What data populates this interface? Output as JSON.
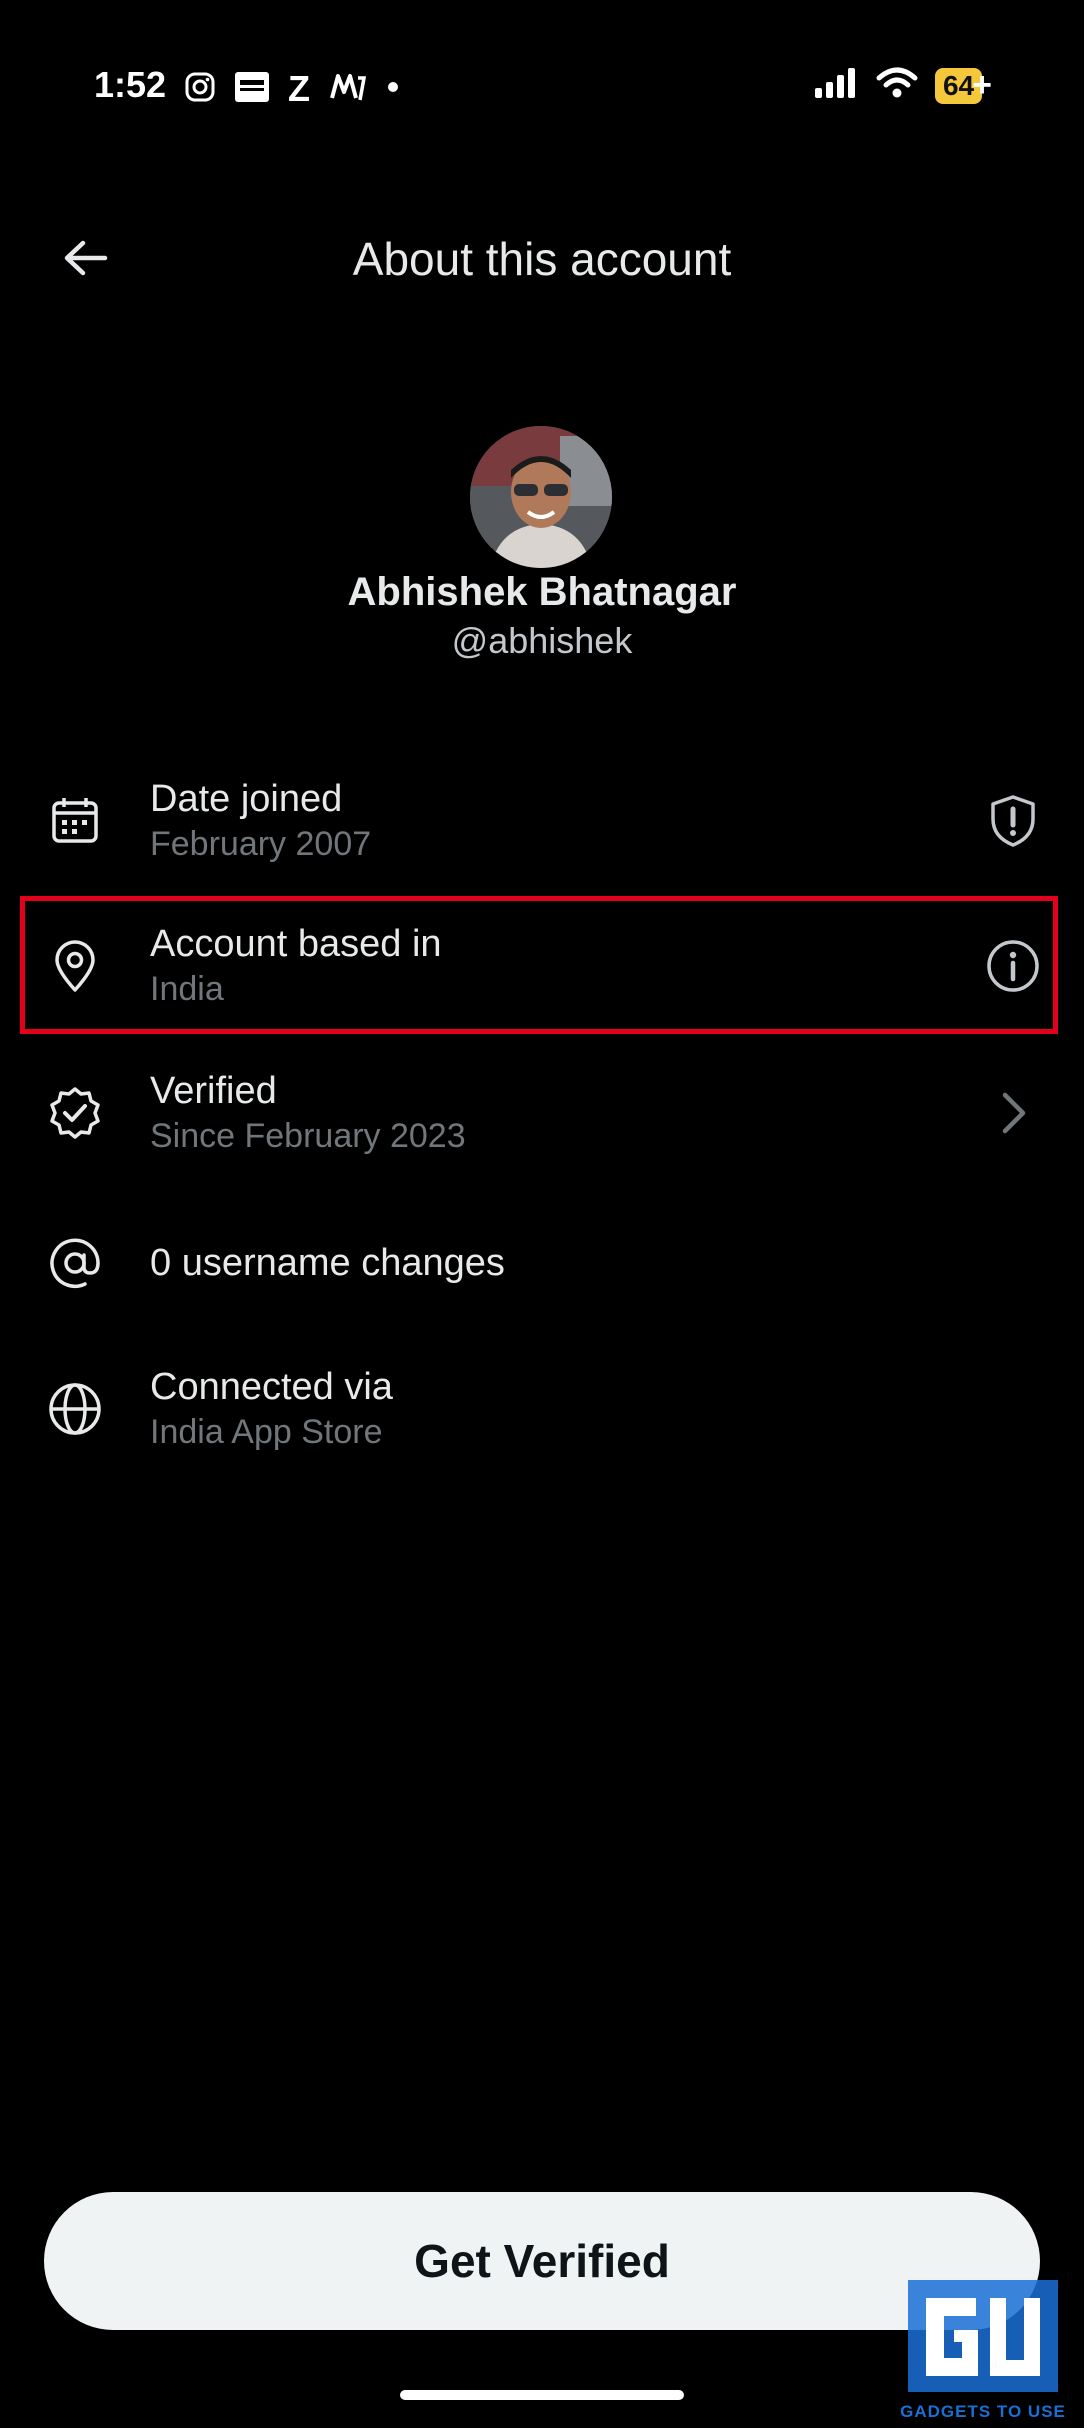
{
  "status_bar": {
    "time": "1:52",
    "battery": "64",
    "battery_suffix": "+",
    "zee_label": "Z",
    "app_icons": [
      "instagram-icon",
      "espncricinfo-icon",
      "zee5-icon",
      "myntra-icon",
      "dot-icon"
    ]
  },
  "header": {
    "title": "About this account"
  },
  "profile": {
    "name": "Abhishek Bhatnagar",
    "handle": "@abhishek"
  },
  "rows": [
    {
      "title": "Date joined",
      "subtitle": "February 2007",
      "icon": "calendar-icon",
      "trailing": "shield-icon"
    },
    {
      "title": "Account based in",
      "subtitle": "India",
      "icon": "location-pin-icon",
      "trailing": "info-icon"
    },
    {
      "title": "Verified",
      "subtitle": "Since February 2023",
      "icon": "verified-badge-icon",
      "trailing": "chevron-right-icon"
    },
    {
      "title": "0 username changes",
      "subtitle": "",
      "icon": "at-sign-icon",
      "trailing": ""
    },
    {
      "title": "Connected via",
      "subtitle": "India App Store",
      "icon": "globe-icon",
      "trailing": ""
    }
  ],
  "cta": {
    "label": "Get Verified"
  },
  "watermark": {
    "text": "GADGETS TO USE"
  },
  "colors": {
    "background": "#000000",
    "primary_text": "#e7e9ea",
    "secondary_text": "#71767b",
    "highlight_border": "#e3001b",
    "button_bg": "#eff3f4",
    "battery": "#f4c83a"
  }
}
